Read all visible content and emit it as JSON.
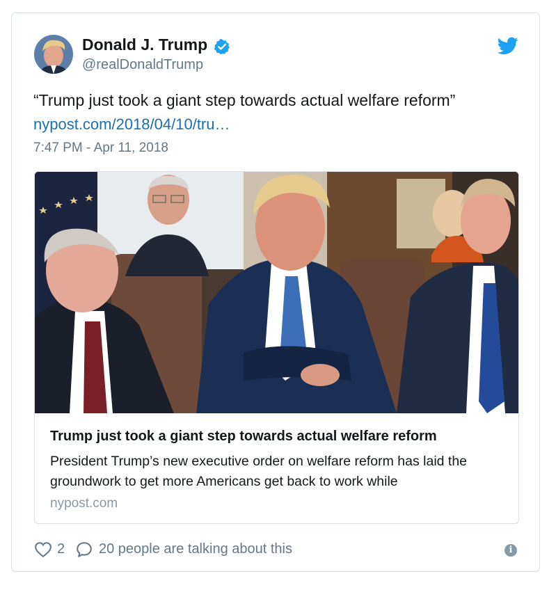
{
  "author": {
    "name": "Donald J. Trump",
    "handle": "@realDonaldTrump",
    "verified": true
  },
  "tweet": {
    "text": "“Trump just took a giant step towards actual welfare reform”",
    "link_text": "nypost.com/2018/04/10/tru…",
    "timestamp": "7:47 PM - Apr 11, 2018"
  },
  "link_card": {
    "title": "Trump just took a giant step towards actual welfare reform",
    "description": "President Trump’s new executive order on welfare reform has laid the groundwork to get more Americans get back to work while",
    "domain": "nypost.com"
  },
  "footer": {
    "like_count": "2",
    "talking_text": "20 people are talking about this"
  },
  "colors": {
    "link_blue": "#1b6fae",
    "twitter_blue": "#1da1f2",
    "muted_gray": "#657786",
    "border": "#d9dfe4"
  },
  "icons": [
    "verified-badge-icon",
    "twitter-bird-icon",
    "heart-icon",
    "reply-bubble-icon",
    "info-icon"
  ]
}
